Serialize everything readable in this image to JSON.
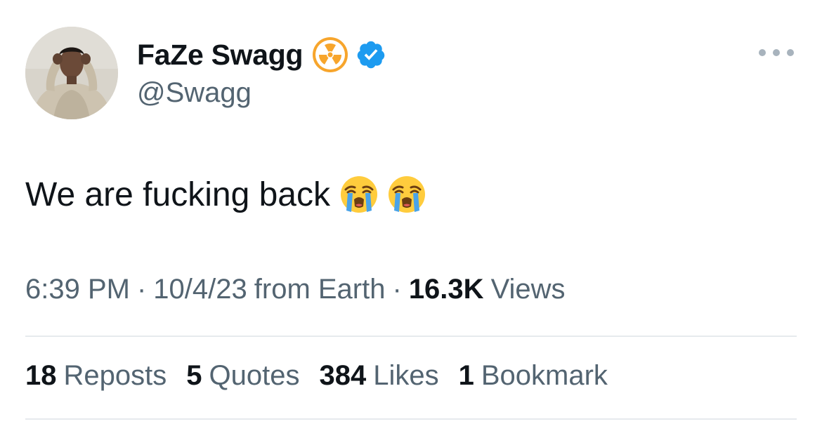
{
  "author": {
    "display_name": "FaZe Swagg",
    "handle": "@Swagg",
    "badges": [
      "radiation-icon",
      "verified-icon"
    ]
  },
  "tweet": {
    "text": "We are fucking back",
    "emojis": [
      "loudly-crying-face-icon",
      "loudly-crying-face-icon"
    ]
  },
  "meta": {
    "time": "6:39 PM",
    "separator": "·",
    "date": "10/4/23",
    "source": "from Earth",
    "views_count": "16.3K",
    "views_label": "Views"
  },
  "stats": [
    {
      "count": "18",
      "label": "Reposts"
    },
    {
      "count": "5",
      "label": "Quotes"
    },
    {
      "count": "384",
      "label": "Likes"
    },
    {
      "count": "1",
      "label": "Bookmark"
    }
  ],
  "colors": {
    "text_primary": "#0f1419",
    "text_secondary": "#536471",
    "verified_blue": "#1d9bf0",
    "radiation_orange": "#f5a623",
    "divider": "#e6eaed"
  }
}
